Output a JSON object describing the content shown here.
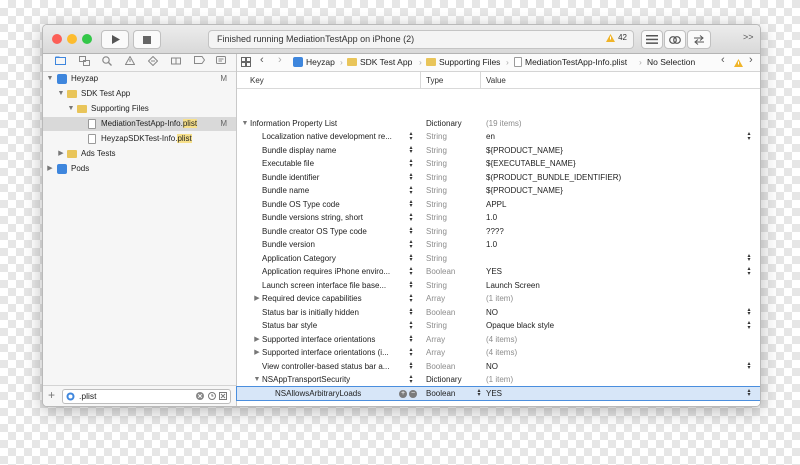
{
  "toolbar": {
    "run_icon": "play-icon",
    "stop_icon": "stop-icon",
    "status": "Finished running MediationTestApp on iPhone (2)",
    "warning_count": "42",
    "overflow": ">>"
  },
  "navigator": {
    "tree": [
      {
        "label": "Heyzap",
        "badge": "M"
      },
      {
        "label": "SDK Test App",
        "badge": ""
      },
      {
        "label": "Supporting Files",
        "badge": ""
      },
      {
        "label_pre": "MediationTestApp-Info.",
        "label_hl": "plist",
        "badge": "M"
      },
      {
        "label_pre": "HeyzapSDKTest-Info.",
        "label_hl": "plist",
        "badge": ""
      },
      {
        "label": "Ads Tests",
        "badge": ""
      },
      {
        "label": "Pods",
        "badge": ""
      }
    ],
    "add": "+",
    "filter_value": ".plist"
  },
  "jumpbar": {
    "crumbs": [
      "Heyzap",
      "SDK Test App",
      "Supporting Files",
      "MediationTestApp-Info.plist",
      "No Selection"
    ]
  },
  "table": {
    "headers": {
      "key": "Key",
      "type": "Type",
      "value": "Value"
    },
    "rows": [
      {
        "key": "Information Property List",
        "type": "Dictionary",
        "value": "(19 items)"
      },
      {
        "key": "Localization native development re...",
        "type": "String",
        "value": "en"
      },
      {
        "key": "Bundle display name",
        "type": "String",
        "value": "${PRODUCT_NAME}"
      },
      {
        "key": "Executable file",
        "type": "String",
        "value": "${EXECUTABLE_NAME}"
      },
      {
        "key": "Bundle identifier",
        "type": "String",
        "value": "$(PRODUCT_BUNDLE_IDENTIFIER)"
      },
      {
        "key": "Bundle name",
        "type": "String",
        "value": "${PRODUCT_NAME}"
      },
      {
        "key": "Bundle OS Type code",
        "type": "String",
        "value": "APPL"
      },
      {
        "key": "Bundle versions string, short",
        "type": "String",
        "value": "1.0"
      },
      {
        "key": "Bundle creator OS Type code",
        "type": "String",
        "value": "????"
      },
      {
        "key": "Bundle version",
        "type": "String",
        "value": "1.0"
      },
      {
        "key": "Application Category",
        "type": "String",
        "value": ""
      },
      {
        "key": "Application requires iPhone enviro...",
        "type": "Boolean",
        "value": "YES"
      },
      {
        "key": "Launch screen interface file base...",
        "type": "String",
        "value": "Launch Screen"
      },
      {
        "key": "Required device capabilities",
        "type": "Array",
        "value": "(1 item)"
      },
      {
        "key": "Status bar is initially hidden",
        "type": "Boolean",
        "value": "NO"
      },
      {
        "key": "Status bar style",
        "type": "String",
        "value": "Opaque black style"
      },
      {
        "key": "Supported interface orientations",
        "type": "Array",
        "value": "(4 items)"
      },
      {
        "key": "Supported interface orientations (i...",
        "type": "Array",
        "value": "(4 items)"
      },
      {
        "key": "View controller-based status bar a...",
        "type": "Boolean",
        "value": "NO"
      },
      {
        "key": "NSAppTransportSecurity",
        "type": "Dictionary",
        "value": "(1 item)"
      },
      {
        "key": "NSAllowsArbitraryLoads",
        "type": "Boolean",
        "value": "YES"
      }
    ]
  },
  "colors": {
    "selection": "#d7e6f8",
    "selection_border": "#4a8ede",
    "close": "#fc5f57",
    "minimize": "#fdbc2e",
    "zoom": "#33c748",
    "folder": "#e9c55a",
    "match_highlight": "#f7e08a"
  }
}
